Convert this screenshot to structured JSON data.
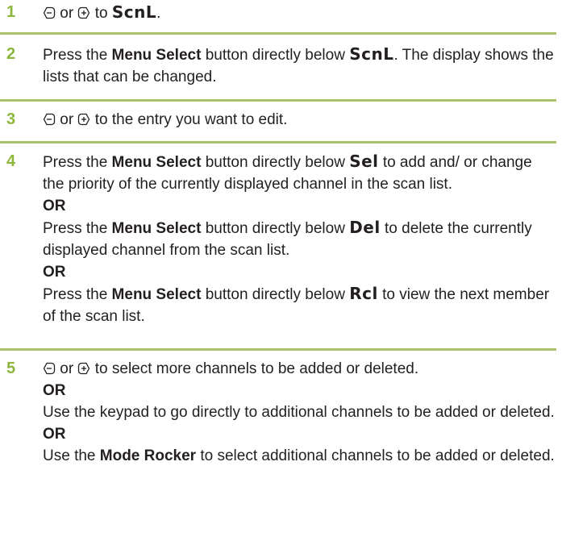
{
  "steps": [
    {
      "number": "1",
      "or_word": "or",
      "to_text": "to",
      "target": "ScnL",
      "end": "."
    },
    {
      "number": "2",
      "pre": "Press the",
      "button": "Menu Select",
      "mid": "button directly below",
      "target": "ScnL",
      "post": ". The display shows the lists that can be changed."
    },
    {
      "number": "3",
      "or_word": "or",
      "post": "to the entry you want to edit."
    },
    {
      "number": "4",
      "para1_pre": "Press the",
      "para1_button": "Menu Select",
      "para1_mid": "button directly below",
      "para1_target": "Sel",
      "para1_post": "to add and/ or change the priority of the currently displayed channel in the scan list.",
      "or1": "OR",
      "para2_pre": "Press the",
      "para2_button": "Menu Select",
      "para2_mid": "button directly below",
      "para2_target": "Del",
      "para2_post": "to delete the currently displayed channel from the scan list.",
      "or2": "OR",
      "para3_pre": "Press the",
      "para3_button": "Menu Select",
      "para3_mid": "button directly below",
      "para3_target": "Rcl",
      "para3_post": "to view the next member of the scan list."
    },
    {
      "number": "5",
      "or_word": "or",
      "line1_post": "to select more channels to be added or deleted.",
      "or1": "OR",
      "para2": "Use the keypad to go directly to additional channels to be added or deleted.",
      "or2": "OR",
      "para3_pre": "Use the",
      "para3_button": "Mode Rocker",
      "para3_post": "to select additional channels to be added or deleted."
    }
  ],
  "colors": {
    "accent": "#8db63c",
    "rule": "#a7c26b",
    "text": "#231f20"
  }
}
